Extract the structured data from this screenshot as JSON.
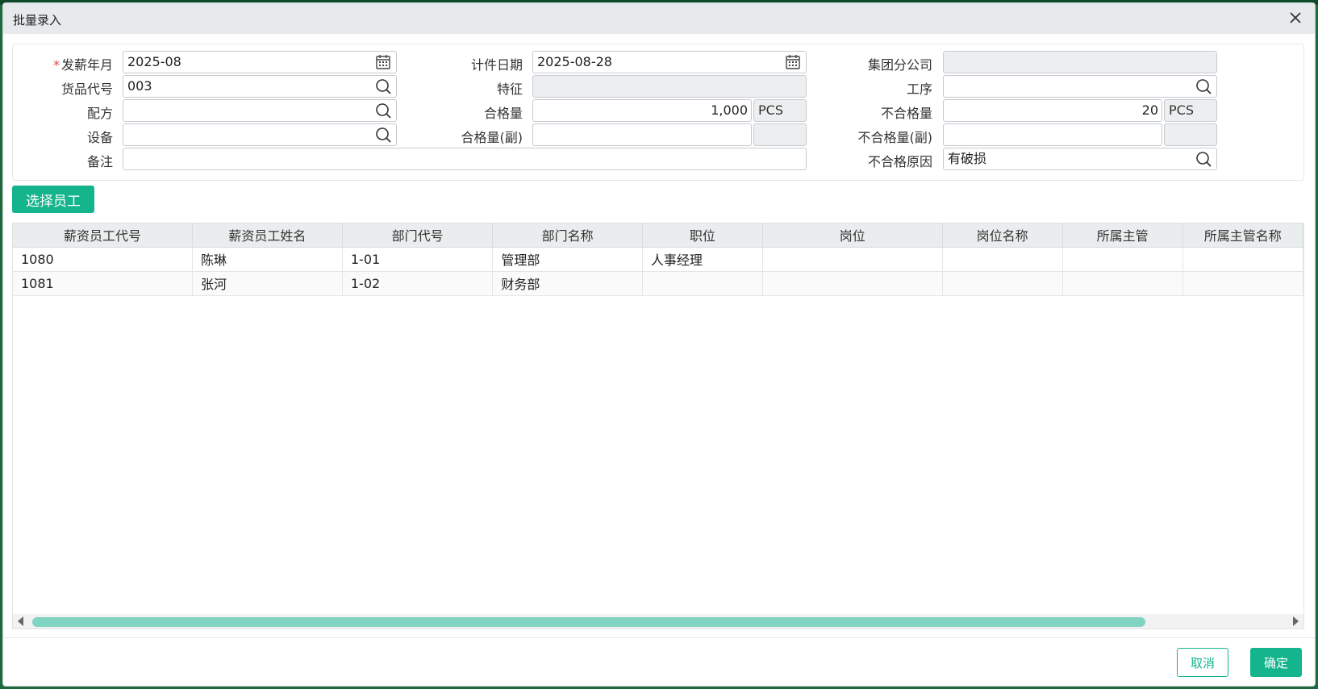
{
  "dialog": {
    "title": "批量录入"
  },
  "form": {
    "pay_month": {
      "label": "发薪年月",
      "required_mark": "*",
      "value": "2025-08"
    },
    "piece_date": {
      "label": "计件日期",
      "value": "2025-08-28"
    },
    "group_branch": {
      "label": "集团分公司",
      "value": ""
    },
    "item_code": {
      "label": "货品代号",
      "value": "003"
    },
    "feature": {
      "label": "特征",
      "value": ""
    },
    "process": {
      "label": "工序",
      "value": ""
    },
    "formula": {
      "label": "配方",
      "value": ""
    },
    "qualified_qty": {
      "label": "合格量",
      "value": "1,000",
      "unit": "PCS"
    },
    "unqualified_qty": {
      "label": "不合格量",
      "value": "20",
      "unit": "PCS"
    },
    "equipment": {
      "label": "设备",
      "value": ""
    },
    "qualified_qty_sub": {
      "label": "合格量(副)",
      "value": "",
      "unit": ""
    },
    "unqualified_qty_sub": {
      "label": "不合格量(副)",
      "value": "",
      "unit": ""
    },
    "remark": {
      "label": "备注",
      "value": ""
    },
    "unqualified_reason": {
      "label": "不合格原因",
      "value": "有破损"
    }
  },
  "select_employee_button": "选择员工",
  "table": {
    "columns": [
      "薪资员工代号",
      "薪资员工姓名",
      "部门代号",
      "部门名称",
      "职位",
      "岗位",
      "岗位名称",
      "所属主管",
      "所属主管名称"
    ],
    "rows": [
      [
        "1080",
        "陈琳",
        "1-01",
        "管理部",
        "人事经理",
        "",
        "",
        "",
        ""
      ],
      [
        "1081",
        "张河",
        "1-02",
        "财务部",
        "",
        "",
        "",
        "",
        ""
      ]
    ]
  },
  "footer": {
    "cancel": "取消",
    "confirm": "确定"
  },
  "colors": {
    "accent": "#14b48c",
    "titlebar": "#e6eaed",
    "required": "#e14a4a"
  },
  "icons": {
    "calendar": "calendar-icon",
    "search": "search-icon",
    "close": "close-icon"
  }
}
